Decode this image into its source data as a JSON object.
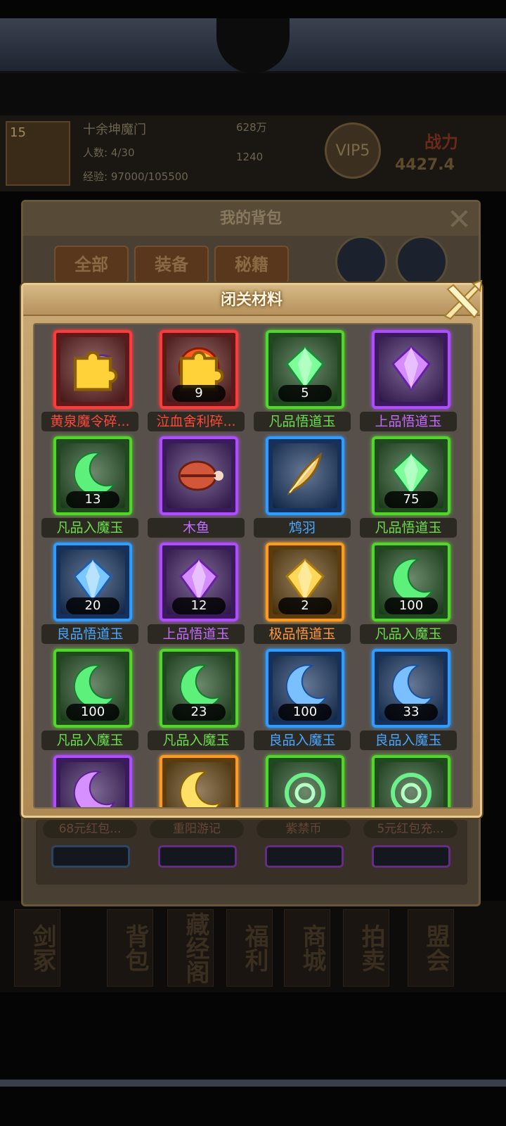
{
  "background": {
    "sect_name": "十余坤魔门",
    "level": "15",
    "members": "人数: 4/30",
    "exp": "经验: 97000/105500",
    "silver": "628万",
    "gold": "1240",
    "vip": "VIP5",
    "power_label": "战力",
    "power_value": "4427.4"
  },
  "bag": {
    "title": "我的背包",
    "tabs": [
      "全部",
      "装备",
      "秘籍"
    ],
    "peek_names": [
      "68元红包...",
      "重阳游记",
      "紫禁币",
      "5元红包充..."
    ]
  },
  "bottom_nav": [
    "剑冢",
    "背包",
    "藏经阁",
    "福利",
    "商城",
    "拍卖",
    "盟会"
  ],
  "popup": {
    "title": "闭关材料"
  },
  "items": [
    {
      "name": "黄泉魔令碎...",
      "count": "",
      "quality": "red",
      "icon": "shard-purple",
      "badge": true,
      "name_color": "red"
    },
    {
      "name": "泣血舍利碎...",
      "count": "9",
      "quality": "red",
      "icon": "orb-fire",
      "badge": true,
      "name_color": "red"
    },
    {
      "name": "凡品悟道玉",
      "count": "5",
      "quality": "green",
      "icon": "gem-green",
      "badge": false,
      "name_color": "green"
    },
    {
      "name": "上品悟道玉",
      "count": "",
      "quality": "purple",
      "icon": "gem-purple",
      "badge": false,
      "name_color": "purple"
    },
    {
      "name": "凡品入魔玉",
      "count": "13",
      "quality": "green",
      "icon": "moon-green",
      "badge": false,
      "name_color": "green"
    },
    {
      "name": "木鱼",
      "count": "",
      "quality": "purple",
      "icon": "woodfish",
      "badge": false,
      "name_color": "purple"
    },
    {
      "name": "鸩羽",
      "count": "",
      "quality": "blue",
      "icon": "feather",
      "badge": false,
      "name_color": "blue"
    },
    {
      "name": "凡品悟道玉",
      "count": "75",
      "quality": "green",
      "icon": "gem-green",
      "badge": false,
      "name_color": "green"
    },
    {
      "name": "良品悟道玉",
      "count": "20",
      "quality": "blue",
      "icon": "gem-blue",
      "badge": false,
      "name_color": "blue"
    },
    {
      "name": "上品悟道玉",
      "count": "12",
      "quality": "purple",
      "icon": "gem-purple",
      "badge": false,
      "name_color": "purple"
    },
    {
      "name": "极品悟道玉",
      "count": "2",
      "quality": "gold",
      "icon": "gem-gold",
      "badge": false,
      "name_color": "orange"
    },
    {
      "name": "凡品入魔玉",
      "count": "100",
      "quality": "green",
      "icon": "moon-green",
      "badge": false,
      "name_color": "green"
    },
    {
      "name": "凡品入魔玉",
      "count": "100",
      "quality": "green",
      "icon": "moon-green",
      "badge": false,
      "name_color": "green"
    },
    {
      "name": "凡品入魔玉",
      "count": "23",
      "quality": "green",
      "icon": "moon-green",
      "badge": false,
      "name_color": "green"
    },
    {
      "name": "良品入魔玉",
      "count": "100",
      "quality": "blue",
      "icon": "moon-blue",
      "badge": false,
      "name_color": "blue"
    },
    {
      "name": "良品入魔玉",
      "count": "33",
      "quality": "blue",
      "icon": "moon-blue",
      "badge": false,
      "name_color": "blue"
    },
    {
      "name": "",
      "count": "",
      "quality": "purple",
      "icon": "moon-purple",
      "badge": false,
      "name_color": "purple"
    },
    {
      "name": "",
      "count": "",
      "quality": "gold",
      "icon": "moon-gold",
      "badge": false,
      "name_color": "orange"
    },
    {
      "name": "",
      "count": "",
      "quality": "green",
      "icon": "swirl-green",
      "badge": false,
      "name_color": "green"
    },
    {
      "name": "",
      "count": "",
      "quality": "green",
      "icon": "swirl-green",
      "badge": false,
      "name_color": "green"
    }
  ],
  "colors": {
    "red": "#ff3a3a",
    "green": "#52d62a",
    "purple": "#b04cff",
    "blue": "#2f9cff",
    "gold": "#ff9a1a"
  }
}
